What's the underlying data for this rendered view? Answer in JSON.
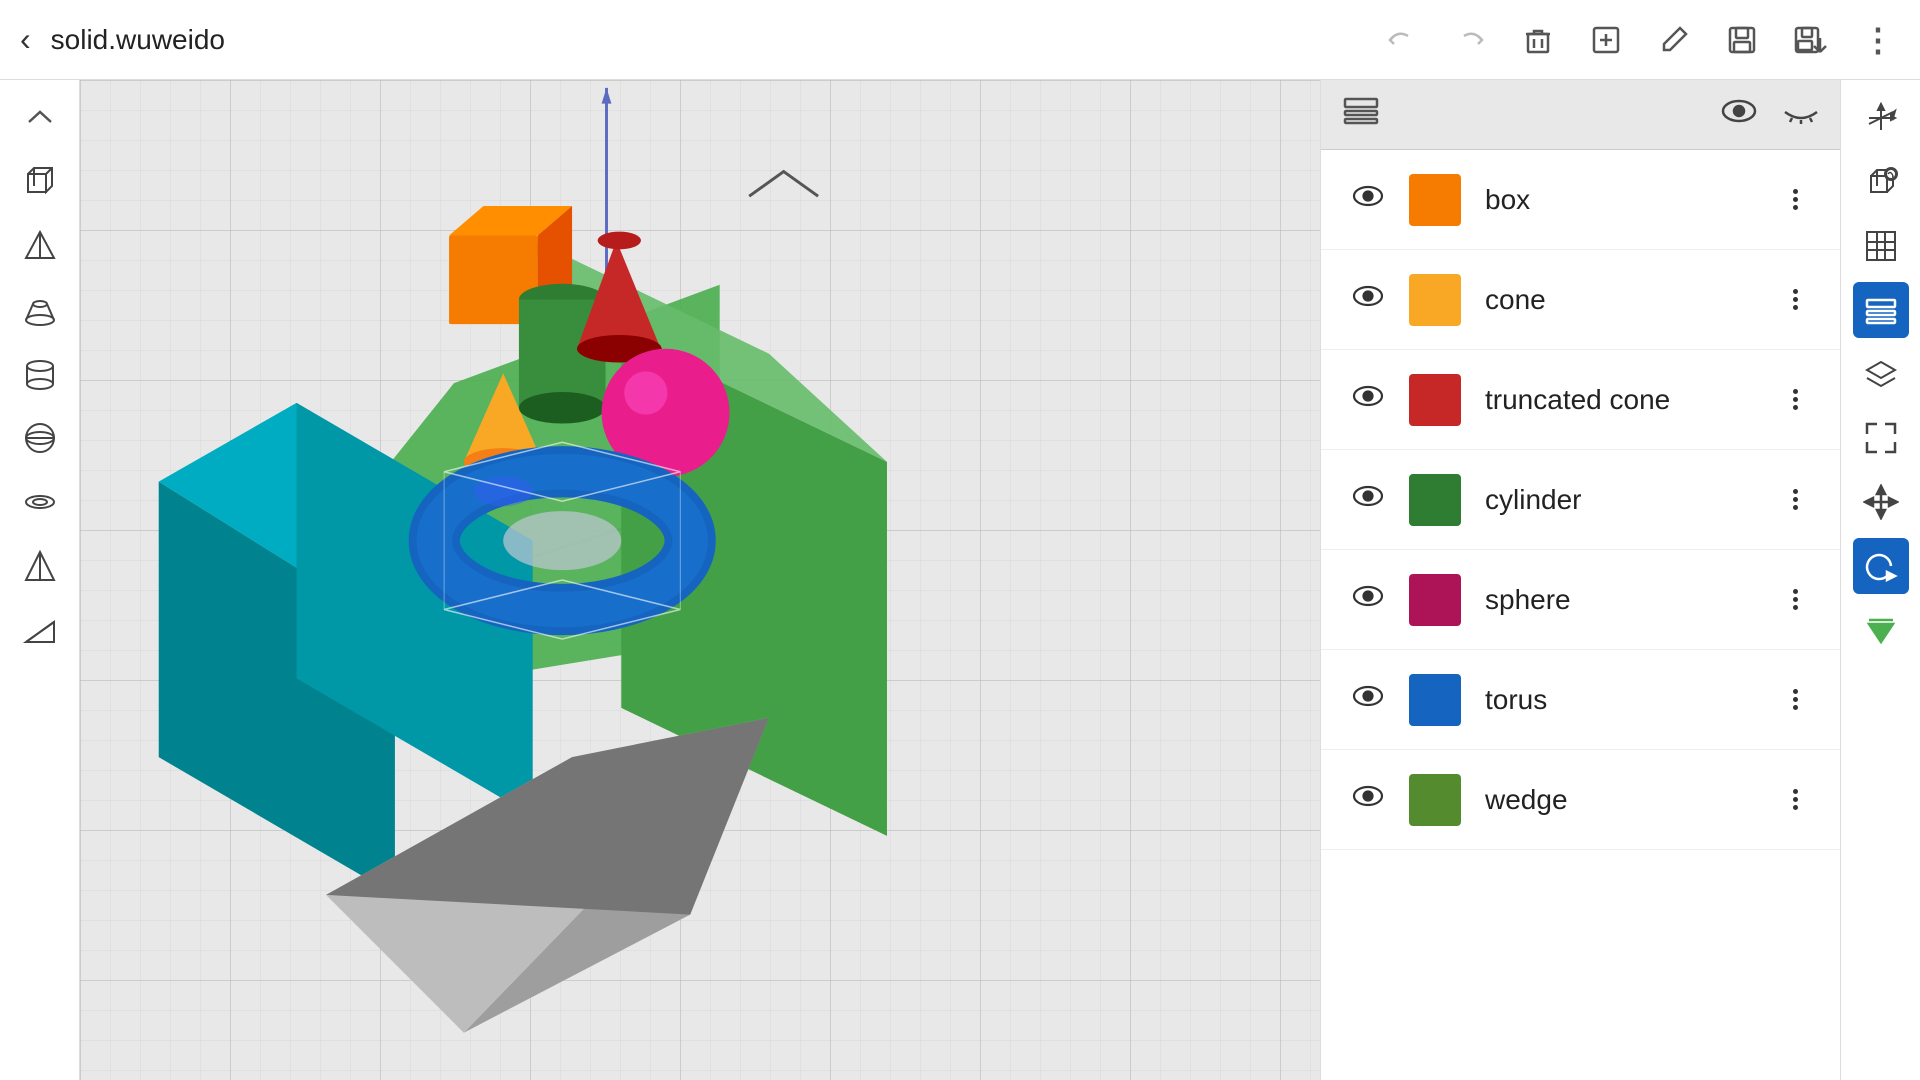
{
  "header": {
    "title": "solid.wuweido",
    "back_label": "←",
    "toolbar_buttons": [
      {
        "id": "back",
        "label": "←",
        "icon": "arrow-left"
      },
      {
        "id": "forward",
        "label": "→",
        "icon": "arrow-right"
      },
      {
        "id": "delete",
        "label": "🗑",
        "icon": "trash"
      },
      {
        "id": "add-group",
        "label": "⊞",
        "icon": "add-group"
      },
      {
        "id": "edit",
        "label": "✎",
        "icon": "edit"
      },
      {
        "id": "save",
        "label": "💾",
        "icon": "save"
      },
      {
        "id": "save-as",
        "label": "💾+",
        "icon": "save-as"
      },
      {
        "id": "more",
        "label": "⋮",
        "icon": "more-vert"
      }
    ]
  },
  "left_toolbar": {
    "tools": [
      {
        "id": "collapse",
        "icon": "chevron-up",
        "label": "^"
      },
      {
        "id": "box-tool",
        "icon": "box",
        "label": "□"
      },
      {
        "id": "pyramid-tool",
        "icon": "pyramid",
        "label": "△"
      },
      {
        "id": "truncated-tool",
        "icon": "truncated",
        "label": "⌂"
      },
      {
        "id": "cylinder-tool",
        "icon": "cylinder",
        "label": "⊙"
      },
      {
        "id": "globe-tool",
        "icon": "globe",
        "label": "⊕"
      },
      {
        "id": "torus-tool",
        "icon": "torus",
        "label": "◎"
      },
      {
        "id": "prism-tool",
        "icon": "prism",
        "label": "◁"
      },
      {
        "id": "wedge-tool",
        "icon": "wedge",
        "label": "◇"
      }
    ]
  },
  "right_toolbar": {
    "tools": [
      {
        "id": "axis-icon",
        "icon": "axis",
        "label": "⌖",
        "active": false
      },
      {
        "id": "view-cube",
        "icon": "cube-view",
        "label": "⬡",
        "active": false
      },
      {
        "id": "grid-icon",
        "icon": "grid",
        "label": "⊞",
        "active": false
      },
      {
        "id": "layers-panel",
        "icon": "layers",
        "label": "◫",
        "active": true
      },
      {
        "id": "layers-icon",
        "icon": "layers2",
        "label": "⧉",
        "active": false
      },
      {
        "id": "fit-view",
        "icon": "fit",
        "label": "⛶",
        "active": false
      },
      {
        "id": "move-icon",
        "icon": "move",
        "label": "✛",
        "active": false
      },
      {
        "id": "rotate-icon",
        "icon": "rotate",
        "label": "↺",
        "active": true
      },
      {
        "id": "nav-down",
        "icon": "nav-down",
        "label": "⇩",
        "active": false
      }
    ]
  },
  "panel": {
    "header_icon": "layers",
    "visible_icon": "👁",
    "hidden_icon": "~",
    "shapes": [
      {
        "id": "box",
        "name": "box",
        "color": "#f57c00",
        "visible": true
      },
      {
        "id": "cone",
        "name": "cone",
        "color": "#f9a825",
        "visible": true
      },
      {
        "id": "truncated_cone",
        "name": "truncated cone",
        "color": "#c62828",
        "visible": true
      },
      {
        "id": "cylinder",
        "name": "cylinder",
        "color": "#2e7d32",
        "visible": true
      },
      {
        "id": "sphere",
        "name": "sphere",
        "color": "#ad1457",
        "visible": true
      },
      {
        "id": "torus",
        "name": "torus",
        "color": "#1565c0",
        "visible": true
      },
      {
        "id": "wedge",
        "name": "wedge",
        "color": "#558b2f",
        "visible": true
      }
    ]
  },
  "scene": {
    "axis_color": "#5c6bc0",
    "background_color": "#e0e0e0"
  }
}
